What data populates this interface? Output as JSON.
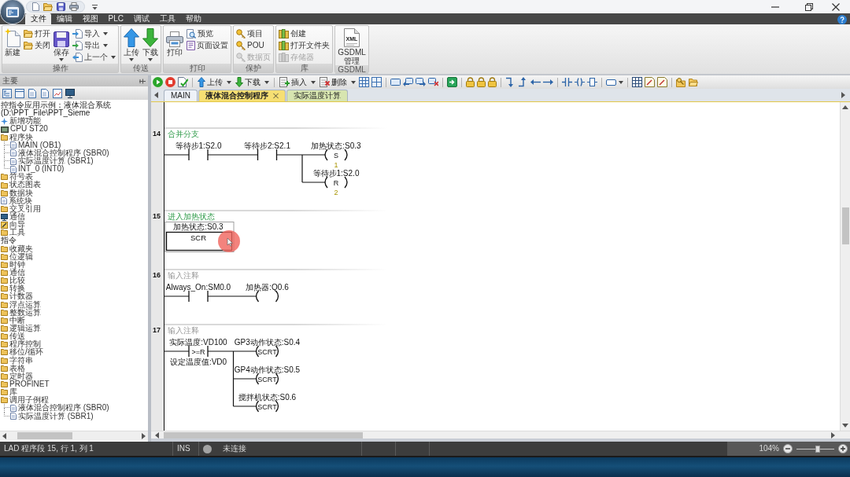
{
  "ribbon": {
    "tabs": [
      {
        "label": "文件",
        "selected": true
      },
      {
        "label": "编辑",
        "selected": false
      },
      {
        "label": "视图",
        "selected": false
      },
      {
        "label": "PLC",
        "selected": false
      },
      {
        "label": "调试",
        "selected": false
      },
      {
        "label": "工具",
        "selected": false
      },
      {
        "label": "帮助",
        "selected": false
      }
    ],
    "groups": [
      {
        "label": "操作",
        "columns": [
          [
            {
              "label": "新建",
              "kind": "large",
              "dropdown": false,
              "disabled": false
            }
          ],
          [
            {
              "label": "打开",
              "kind": "small",
              "dropdown": false,
              "disabled": false
            },
            {
              "label": "关闭",
              "kind": "small",
              "dropdown": false,
              "disabled": false
            }
          ],
          [
            {
              "label": "保存",
              "kind": "large",
              "dropdown": true,
              "disabled": false
            }
          ],
          [
            {
              "label": "导入",
              "kind": "small",
              "dropdown": true,
              "disabled": false
            },
            {
              "label": "导出",
              "kind": "small",
              "dropdown": true,
              "disabled": false
            },
            {
              "label": "上一个",
              "kind": "small",
              "dropdown": true,
              "disabled": false
            }
          ]
        ]
      },
      {
        "label": "传送",
        "columns": [
          [
            {
              "label": "上传",
              "kind": "large",
              "dropdown": true,
              "disabled": false
            }
          ],
          [
            {
              "label": "下载",
              "kind": "large",
              "dropdown": true,
              "disabled": false
            }
          ]
        ]
      },
      {
        "label": "打印",
        "columns": [
          [
            {
              "label": "打印",
              "kind": "large",
              "dropdown": false,
              "disabled": false
            }
          ],
          [
            {
              "label": "预览",
              "kind": "small",
              "dropdown": false,
              "disabled": false
            },
            {
              "label": "页面设置",
              "kind": "small",
              "dropdown": false,
              "disabled": false
            }
          ]
        ]
      },
      {
        "label": "保护",
        "columns": [
          [
            {
              "label": "项目",
              "kind": "small",
              "dropdown": false,
              "disabled": false
            },
            {
              "label": "POU",
              "kind": "small",
              "dropdown": false,
              "disabled": false
            },
            {
              "label": "数据页",
              "kind": "small",
              "dropdown": false,
              "disabled": true
            }
          ]
        ]
      },
      {
        "label": "库",
        "columns": [
          [
            {
              "label": "创建",
              "kind": "small",
              "dropdown": false,
              "disabled": false
            },
            {
              "label": "打开文件夹",
              "kind": "small",
              "dropdown": false,
              "disabled": false
            },
            {
              "label": "存储器",
              "kind": "small",
              "dropdown": false,
              "disabled": true
            }
          ]
        ]
      },
      {
        "label": "GSDML",
        "columns": [
          [
            {
              "label": "GSDML 管理",
              "kind": "large",
              "dropdown": false,
              "disabled": false,
              "icon_text": "XML"
            }
          ]
        ]
      }
    ]
  },
  "project_tree": {
    "title": "主要",
    "roots": [
      {
        "label": "控指令应用示例：液体混合系统 (D:\\PPT_File\\PPT_Sieme",
        "children": [
          {
            "label": "新增功能"
          },
          {
            "label": "CPU ST20"
          },
          {
            "label": "程序块",
            "children": [
              {
                "label": "MAIN (OB1)"
              },
              {
                "label": "液体混合控制程序 (SBR0)"
              },
              {
                "label": "实际温度计算 (SBR1)"
              },
              {
                "label": "INT_0 (INT0)"
              }
            ]
          },
          {
            "label": "符号表"
          },
          {
            "label": "状态图表"
          },
          {
            "label": "数据块"
          },
          {
            "label": "系统块"
          },
          {
            "label": "交叉引用"
          },
          {
            "label": "通信"
          },
          {
            "label": "向导"
          },
          {
            "label": "工具"
          }
        ]
      },
      {
        "label": "指令",
        "children": [
          {
            "label": "收藏夹"
          },
          {
            "label": "位逻辑"
          },
          {
            "label": "时钟"
          },
          {
            "label": "通信"
          },
          {
            "label": "比较"
          },
          {
            "label": "转换"
          },
          {
            "label": "计数器"
          },
          {
            "label": "浮点运算"
          },
          {
            "label": "整数运算"
          },
          {
            "label": "中断"
          },
          {
            "label": "逻辑运算"
          },
          {
            "label": "传送"
          },
          {
            "label": "程序控制"
          },
          {
            "label": "移位/循环"
          },
          {
            "label": "字符串"
          },
          {
            "label": "表格"
          },
          {
            "label": "定时器"
          },
          {
            "label": "PROFINET"
          },
          {
            "label": "库"
          },
          {
            "label": "调用子例程",
            "children": [
              {
                "label": "液体混合控制程序 (SBR0)"
              },
              {
                "label": "实际温度计算 (SBR1)"
              }
            ]
          }
        ]
      }
    ]
  },
  "editor_toolbar": {
    "buttons": [
      {
        "label": "上传",
        "dropdown": true
      },
      {
        "label": "下载",
        "dropdown": true
      },
      {
        "label": "插入",
        "dropdown": true
      },
      {
        "label": "删除",
        "dropdown": true
      }
    ]
  },
  "editor_tabs": [
    {
      "label": "MAIN",
      "selected": false,
      "color": "#eef2f8"
    },
    {
      "label": "液体混合控制程序",
      "selected": true,
      "color": "#f6df73"
    },
    {
      "label": "实际温度计算",
      "selected": false,
      "color": "#d7e5b0"
    }
  ],
  "networks": [
    {
      "number": "14",
      "comment": "合并分支",
      "contacts": [
        {
          "kind": "no",
          "label": "等待步1:S2.0"
        },
        {
          "kind": "no",
          "label": "等待步2:S2.1"
        }
      ],
      "coils": [
        {
          "label": "加热状态:S0.3",
          "op": "S",
          "count": "1"
        },
        {
          "label": "等待步1:S2.0",
          "op": "R",
          "count": "2"
        }
      ]
    },
    {
      "number": "15",
      "comment": "进入加热状态",
      "box": {
        "label": "加热状态:S0.3",
        "op": "SCR",
        "selected": true
      }
    },
    {
      "number": "16",
      "placeholder": "输入注释",
      "contacts": [
        {
          "kind": "no",
          "label": "Always_On:SM0.0"
        }
      ],
      "coils": [
        {
          "label": "加热器:Q0.6"
        }
      ]
    },
    {
      "number": "17",
      "placeholder": "输入注释",
      "contacts": [
        {
          "kind": "compare",
          "label": "实际温度:VD100",
          "op": ">=R",
          "label_below": "设定温度值:VD0"
        }
      ],
      "coils": [
        {
          "label": "GP3动作状态:S0.4",
          "op": "SCRT"
        },
        {
          "label": "GP4动作状态:S0.5",
          "op": "SCRT"
        },
        {
          "label": "搅拌机状态:S0.6",
          "op": "SCRT"
        }
      ]
    }
  ],
  "status_bar": {
    "position": "LAD 程序段 15, 行 1, 列 1",
    "mode": "INS",
    "connection": {
      "label": "未连接",
      "connected": false
    },
    "zoom": {
      "reading": "104%",
      "level": 0.56
    }
  }
}
